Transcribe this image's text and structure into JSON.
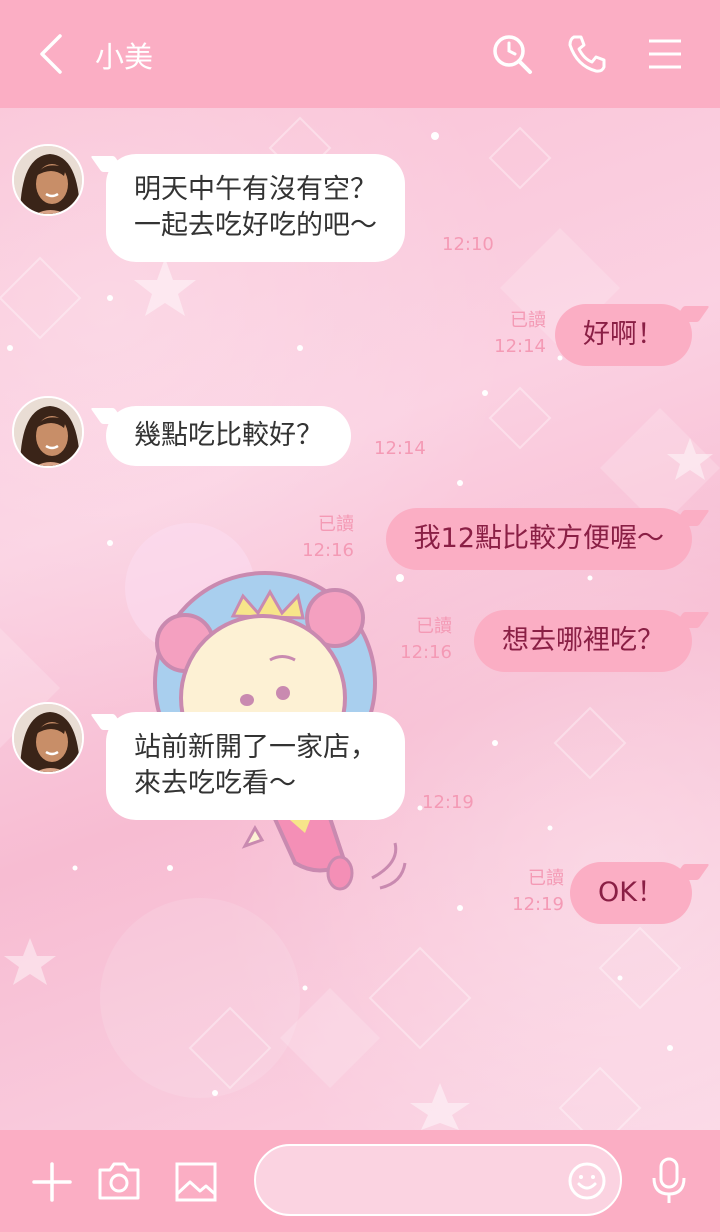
{
  "header": {
    "title": "小美",
    "icons": [
      "back-icon",
      "search-icon",
      "phone-icon",
      "menu-icon"
    ]
  },
  "messages": [
    {
      "side": "incoming",
      "lines": [
        "明天中午有沒有空？",
        "一起去吃好吃的吧～"
      ],
      "time": "12:10"
    },
    {
      "side": "outgoing",
      "lines": [
        "好啊！"
      ],
      "read": "已讀",
      "time": "12:14"
    },
    {
      "side": "incoming",
      "lines": [
        "幾點吃比較好？"
      ],
      "time": "12:14"
    },
    {
      "side": "outgoing",
      "lines": [
        "我12點比較方便喔～"
      ],
      "read": "已讀",
      "time": "12:16"
    },
    {
      "side": "outgoing",
      "lines": [
        "想去哪裡吃？"
      ],
      "read": "已讀",
      "time": "12:16"
    },
    {
      "side": "incoming",
      "lines": [
        "站前新開了一家店，",
        "來去吃吃看～"
      ],
      "time": "12:19"
    },
    {
      "side": "outgoing",
      "lines": [
        "OK！"
      ],
      "read": "已讀",
      "time": "12:19"
    }
  ],
  "footer": {
    "input_placeholder": "",
    "icons": [
      "plus-icon",
      "camera-icon",
      "image-icon",
      "smile-icon",
      "mic-icon"
    ]
  },
  "colors": {
    "header_bg": "#fbaec4",
    "outgoing_bubble": "#fbaec4",
    "outgoing_text": "#8a1f45",
    "incoming_bubble": "#ffffff",
    "meta_text": "#f49ab5"
  }
}
